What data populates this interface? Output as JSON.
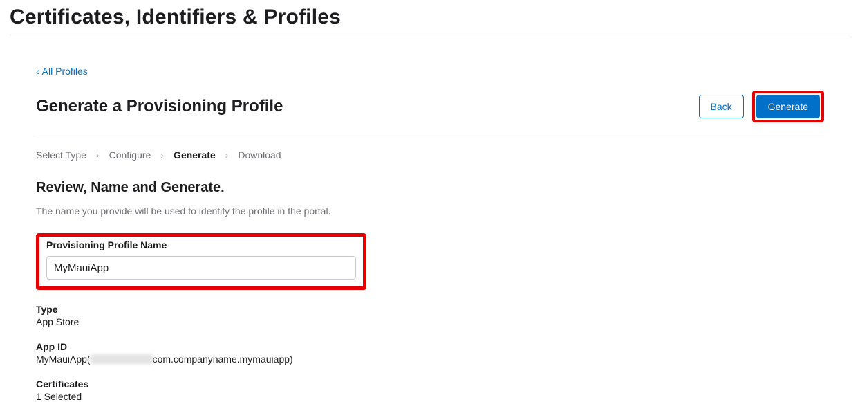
{
  "page": {
    "title": "Certificates, Identifiers & Profiles"
  },
  "back_link": {
    "label": "All Profiles"
  },
  "header": {
    "title": "Generate a Provisioning Profile",
    "back_button": "Back",
    "generate_button": "Generate"
  },
  "breadcrumbs": {
    "step1": "Select Type",
    "step2": "Configure",
    "step3": "Generate",
    "step4": "Download"
  },
  "section": {
    "heading": "Review, Name and Generate.",
    "subheading": "The name you provide will be used to identify the profile in the portal."
  },
  "form": {
    "profile_name_label": "Provisioning Profile Name",
    "profile_name_value": "MyMauiApp"
  },
  "details": {
    "type_label": "Type",
    "type_value": "App Store",
    "appid_label": "App ID",
    "appid_prefix": "MyMauiApp(",
    "appid_suffix": "com.companyname.mymauiapp)",
    "certs_label": "Certificates",
    "certs_value": "1 Selected"
  }
}
